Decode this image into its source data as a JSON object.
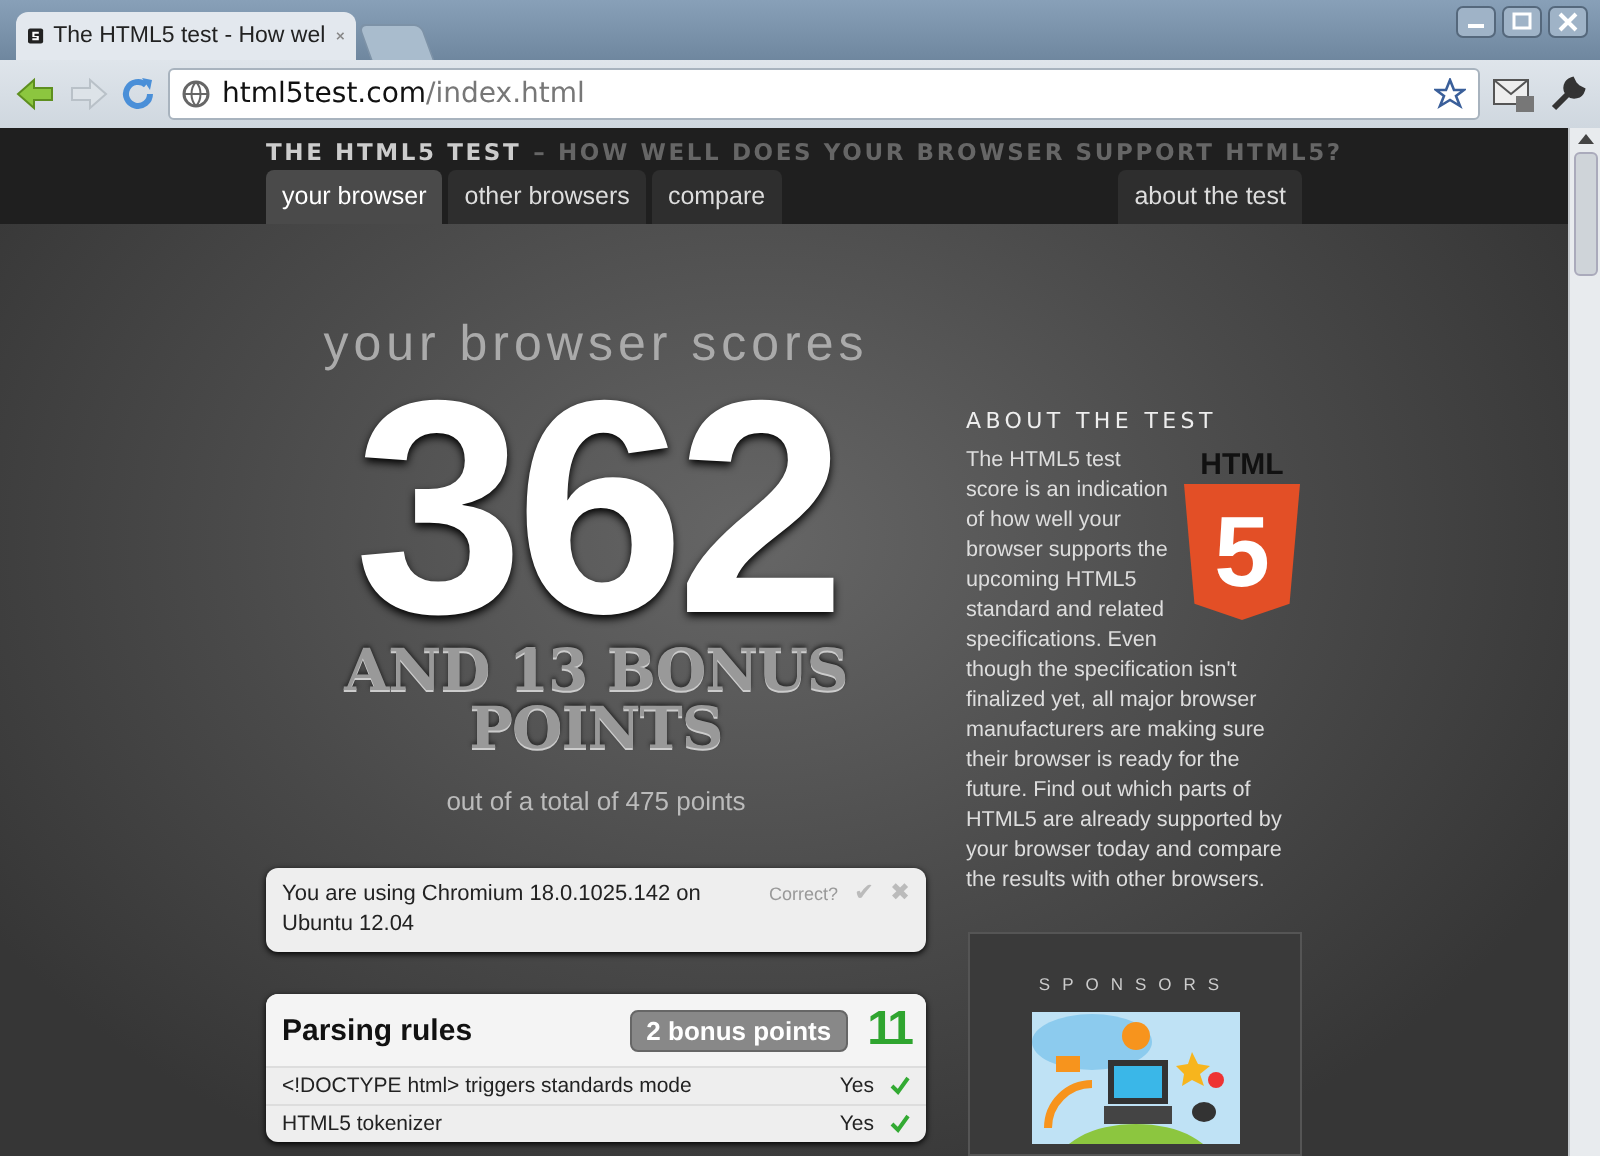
{
  "browser": {
    "tabs": [
      {
        "title": "The HTML5 test - How wel",
        "selected": true
      }
    ],
    "address": {
      "host": "html5test.com",
      "path": "/index.html"
    }
  },
  "site": {
    "title": "THE HTML5 TEST",
    "tagline": "– HOW WELL DOES YOUR BROWSER SUPPORT HTML5?",
    "nav": [
      {
        "label": "your browser",
        "selected": true
      },
      {
        "label": "other browsers",
        "selected": false
      },
      {
        "label": "compare",
        "selected": false
      }
    ],
    "nav_right": [
      {
        "label": "about the test",
        "selected": false
      }
    ]
  },
  "score": {
    "heading": "your browser scores",
    "value": "362",
    "bonus": "AND 13 BONUS POINTS",
    "total": "out of a total of 475 points"
  },
  "detection": {
    "text": "You are using Chromium 18.0.1025.142 on Ubuntu 12.04",
    "prompt": "Correct?",
    "confirm": "✔",
    "reject": "✖"
  },
  "section": {
    "title": "Parsing rules",
    "bonus": "2 bonus points",
    "score": "11",
    "rows": [
      {
        "label": "<!DOCTYPE html> triggers standards mode",
        "result": "Yes",
        "passed": true
      },
      {
        "label": "HTML5 tokenizer",
        "result": "Yes",
        "passed": true
      }
    ]
  },
  "about": {
    "heading": "ABOUT THE TEST",
    "logo_text": "HTML",
    "logo_mark": "5",
    "text_beside_logo": "The HTML5 test score is an indication of how well your browser supports the upcoming HTML5 standard and related specifications. Even",
    "text": "though the specification isn't finalized yet, all major browser manufacturers are making sure their browser is ready for the future. Find out which parts of HTML5 are already supported by your browser today and compare the results with other browsers."
  },
  "sponsors": {
    "heading": "SPONSORS"
  }
}
